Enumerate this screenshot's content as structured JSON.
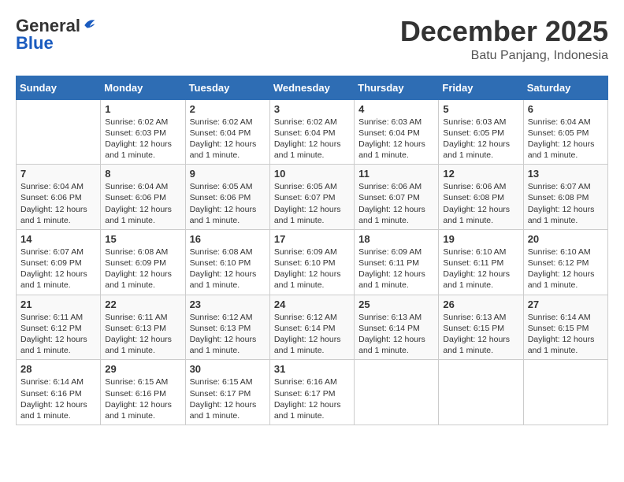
{
  "header": {
    "logo_line1": "General",
    "logo_line2": "Blue",
    "month": "December 2025",
    "location": "Batu Panjang, Indonesia"
  },
  "weekdays": [
    "Sunday",
    "Monday",
    "Tuesday",
    "Wednesday",
    "Thursday",
    "Friday",
    "Saturday"
  ],
  "weeks": [
    [
      {
        "day": "",
        "sunrise": "",
        "sunset": "",
        "daylight": ""
      },
      {
        "day": "1",
        "sunrise": "Sunrise: 6:02 AM",
        "sunset": "Sunset: 6:03 PM",
        "daylight": "Daylight: 12 hours and 1 minute."
      },
      {
        "day": "2",
        "sunrise": "Sunrise: 6:02 AM",
        "sunset": "Sunset: 6:04 PM",
        "daylight": "Daylight: 12 hours and 1 minute."
      },
      {
        "day": "3",
        "sunrise": "Sunrise: 6:02 AM",
        "sunset": "Sunset: 6:04 PM",
        "daylight": "Daylight: 12 hours and 1 minute."
      },
      {
        "day": "4",
        "sunrise": "Sunrise: 6:03 AM",
        "sunset": "Sunset: 6:04 PM",
        "daylight": "Daylight: 12 hours and 1 minute."
      },
      {
        "day": "5",
        "sunrise": "Sunrise: 6:03 AM",
        "sunset": "Sunset: 6:05 PM",
        "daylight": "Daylight: 12 hours and 1 minute."
      },
      {
        "day": "6",
        "sunrise": "Sunrise: 6:04 AM",
        "sunset": "Sunset: 6:05 PM",
        "daylight": "Daylight: 12 hours and 1 minute."
      }
    ],
    [
      {
        "day": "7",
        "sunrise": "Sunrise: 6:04 AM",
        "sunset": "Sunset: 6:06 PM",
        "daylight": "Daylight: 12 hours and 1 minute."
      },
      {
        "day": "8",
        "sunrise": "Sunrise: 6:04 AM",
        "sunset": "Sunset: 6:06 PM",
        "daylight": "Daylight: 12 hours and 1 minute."
      },
      {
        "day": "9",
        "sunrise": "Sunrise: 6:05 AM",
        "sunset": "Sunset: 6:06 PM",
        "daylight": "Daylight: 12 hours and 1 minute."
      },
      {
        "day": "10",
        "sunrise": "Sunrise: 6:05 AM",
        "sunset": "Sunset: 6:07 PM",
        "daylight": "Daylight: 12 hours and 1 minute."
      },
      {
        "day": "11",
        "sunrise": "Sunrise: 6:06 AM",
        "sunset": "Sunset: 6:07 PM",
        "daylight": "Daylight: 12 hours and 1 minute."
      },
      {
        "day": "12",
        "sunrise": "Sunrise: 6:06 AM",
        "sunset": "Sunset: 6:08 PM",
        "daylight": "Daylight: 12 hours and 1 minute."
      },
      {
        "day": "13",
        "sunrise": "Sunrise: 6:07 AM",
        "sunset": "Sunset: 6:08 PM",
        "daylight": "Daylight: 12 hours and 1 minute."
      }
    ],
    [
      {
        "day": "14",
        "sunrise": "Sunrise: 6:07 AM",
        "sunset": "Sunset: 6:09 PM",
        "daylight": "Daylight: 12 hours and 1 minute."
      },
      {
        "day": "15",
        "sunrise": "Sunrise: 6:08 AM",
        "sunset": "Sunset: 6:09 PM",
        "daylight": "Daylight: 12 hours and 1 minute."
      },
      {
        "day": "16",
        "sunrise": "Sunrise: 6:08 AM",
        "sunset": "Sunset: 6:10 PM",
        "daylight": "Daylight: 12 hours and 1 minute."
      },
      {
        "day": "17",
        "sunrise": "Sunrise: 6:09 AM",
        "sunset": "Sunset: 6:10 PM",
        "daylight": "Daylight: 12 hours and 1 minute."
      },
      {
        "day": "18",
        "sunrise": "Sunrise: 6:09 AM",
        "sunset": "Sunset: 6:11 PM",
        "daylight": "Daylight: 12 hours and 1 minute."
      },
      {
        "day": "19",
        "sunrise": "Sunrise: 6:10 AM",
        "sunset": "Sunset: 6:11 PM",
        "daylight": "Daylight: 12 hours and 1 minute."
      },
      {
        "day": "20",
        "sunrise": "Sunrise: 6:10 AM",
        "sunset": "Sunset: 6:12 PM",
        "daylight": "Daylight: 12 hours and 1 minute."
      }
    ],
    [
      {
        "day": "21",
        "sunrise": "Sunrise: 6:11 AM",
        "sunset": "Sunset: 6:12 PM",
        "daylight": "Daylight: 12 hours and 1 minute."
      },
      {
        "day": "22",
        "sunrise": "Sunrise: 6:11 AM",
        "sunset": "Sunset: 6:13 PM",
        "daylight": "Daylight: 12 hours and 1 minute."
      },
      {
        "day": "23",
        "sunrise": "Sunrise: 6:12 AM",
        "sunset": "Sunset: 6:13 PM",
        "daylight": "Daylight: 12 hours and 1 minute."
      },
      {
        "day": "24",
        "sunrise": "Sunrise: 6:12 AM",
        "sunset": "Sunset: 6:14 PM",
        "daylight": "Daylight: 12 hours and 1 minute."
      },
      {
        "day": "25",
        "sunrise": "Sunrise: 6:13 AM",
        "sunset": "Sunset: 6:14 PM",
        "daylight": "Daylight: 12 hours and 1 minute."
      },
      {
        "day": "26",
        "sunrise": "Sunrise: 6:13 AM",
        "sunset": "Sunset: 6:15 PM",
        "daylight": "Daylight: 12 hours and 1 minute."
      },
      {
        "day": "27",
        "sunrise": "Sunrise: 6:14 AM",
        "sunset": "Sunset: 6:15 PM",
        "daylight": "Daylight: 12 hours and 1 minute."
      }
    ],
    [
      {
        "day": "28",
        "sunrise": "Sunrise: 6:14 AM",
        "sunset": "Sunset: 6:16 PM",
        "daylight": "Daylight: 12 hours and 1 minute."
      },
      {
        "day": "29",
        "sunrise": "Sunrise: 6:15 AM",
        "sunset": "Sunset: 6:16 PM",
        "daylight": "Daylight: 12 hours and 1 minute."
      },
      {
        "day": "30",
        "sunrise": "Sunrise: 6:15 AM",
        "sunset": "Sunset: 6:17 PM",
        "daylight": "Daylight: 12 hours and 1 minute."
      },
      {
        "day": "31",
        "sunrise": "Sunrise: 6:16 AM",
        "sunset": "Sunset: 6:17 PM",
        "daylight": "Daylight: 12 hours and 1 minute."
      },
      {
        "day": "",
        "sunrise": "",
        "sunset": "",
        "daylight": ""
      },
      {
        "day": "",
        "sunrise": "",
        "sunset": "",
        "daylight": ""
      },
      {
        "day": "",
        "sunrise": "",
        "sunset": "",
        "daylight": ""
      }
    ]
  ]
}
